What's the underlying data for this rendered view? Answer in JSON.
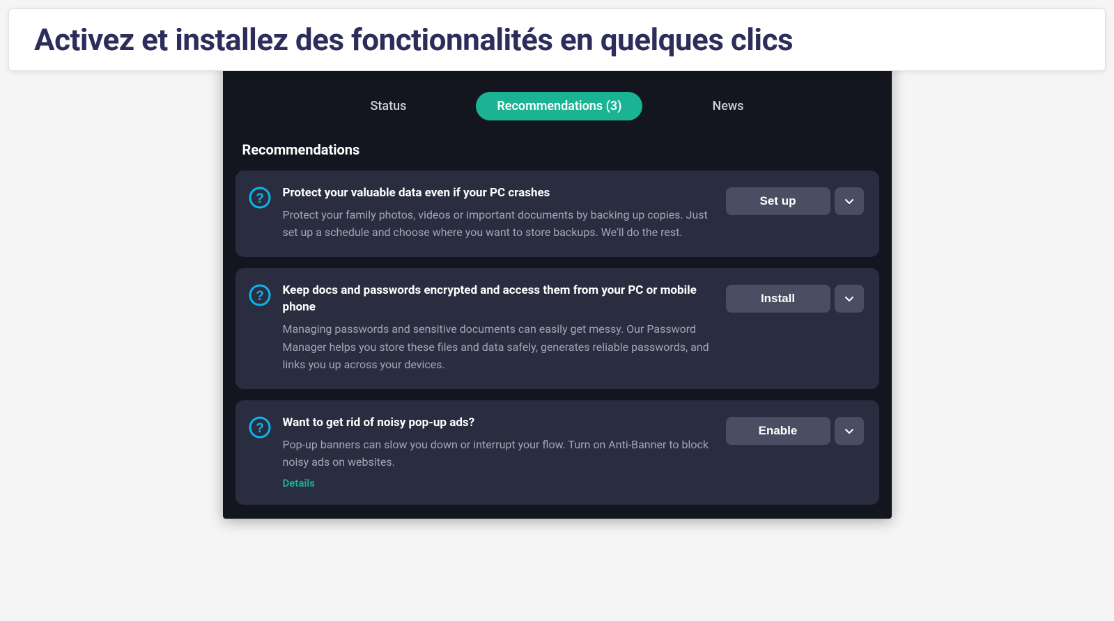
{
  "banner": {
    "headline": "Activez et installez des fonctionnalités en quelques clics"
  },
  "tabs": {
    "items": [
      {
        "label": "Status"
      },
      {
        "label": "Recommendations (3)"
      },
      {
        "label": "News"
      }
    ],
    "active_index": 1
  },
  "section": {
    "title": "Recommendations"
  },
  "recommendations": [
    {
      "title": "Protect your valuable data even if your PC crashes",
      "description": "Protect your family photos, videos or important documents by backing up copies. Just set up a schedule and choose where you want to store backups. We'll do the rest.",
      "action_label": "Set up",
      "details_label": null
    },
    {
      "title": "Keep docs and passwords encrypted and access them from your PC or mobile phone",
      "description": "Managing passwords and sensitive documents can easily get messy. Our Password Manager helps you store these files and data safely, generates reliable passwords, and links you up across your devices.",
      "action_label": "Install",
      "details_label": null
    },
    {
      "title": "Want to get rid of noisy pop-up ads?",
      "description": "Pop-up banners can slow you down or interrupt your flow. Turn on Anti-Banner to block noisy ads on websites.",
      "action_label": "Enable",
      "details_label": "Details"
    }
  ],
  "colors": {
    "accent": "#1ab394",
    "card_bg": "#2a2d3f",
    "window_bg": "#13151f",
    "button_bg": "#4a4e63",
    "headline": "#2d2d5c",
    "icon_ring": "#0bb5e8"
  }
}
